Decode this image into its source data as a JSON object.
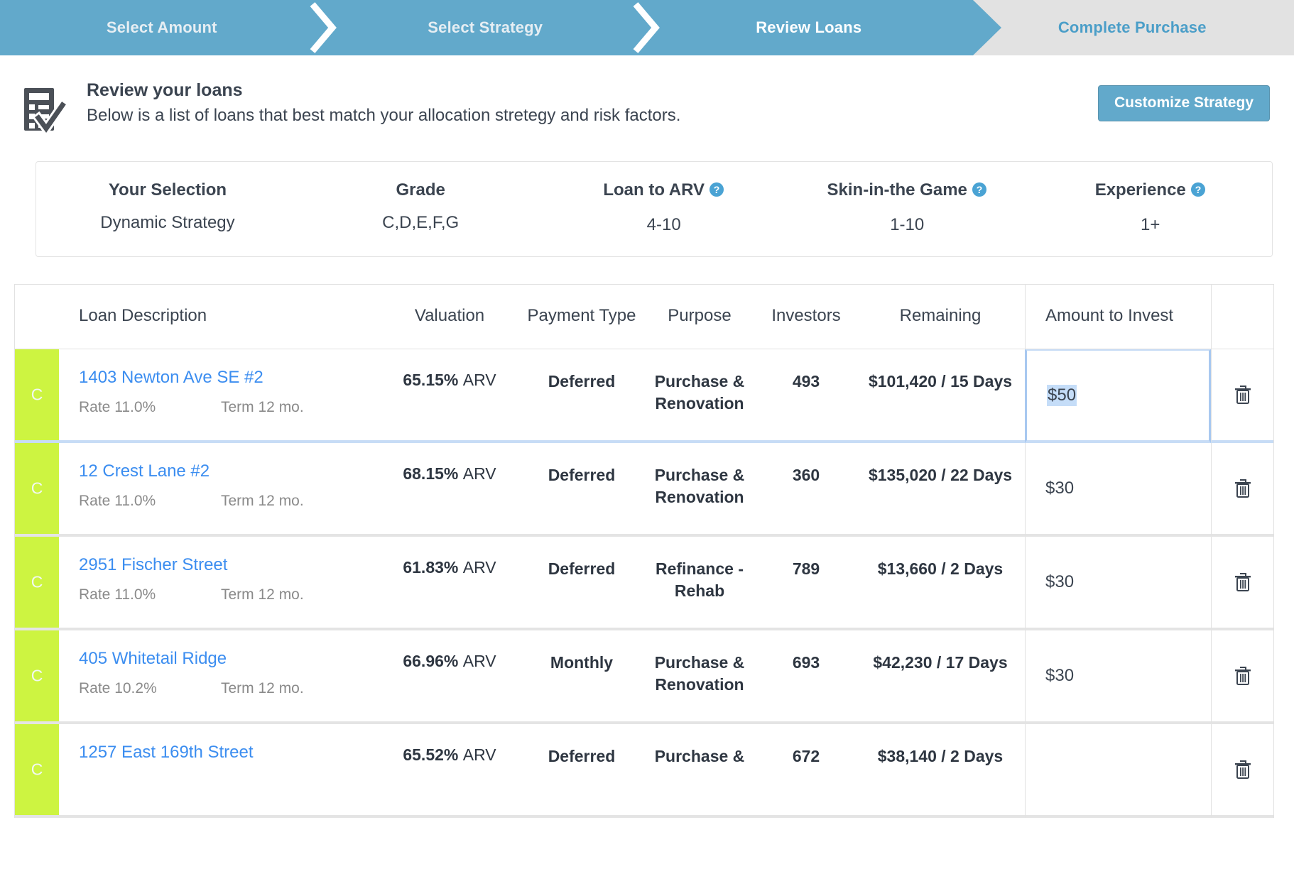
{
  "wizard": {
    "steps": [
      {
        "label": "Select Amount",
        "state": "done"
      },
      {
        "label": "Select Strategy",
        "state": "done"
      },
      {
        "label": "Review Loans",
        "state": "active"
      },
      {
        "label": "Complete Purchase",
        "state": "todo"
      }
    ],
    "fill_color": "#62a9cb",
    "track_color": "#e2e2e2"
  },
  "header": {
    "icon": "clipboard-check-icon",
    "title": "Review your loans",
    "subtitle": "Below is a list of loans that best match your allocation stretegy and risk factors.",
    "customize_button": "Customize Strategy"
  },
  "summary": {
    "columns": [
      {
        "label": "Your Selection",
        "value": "Dynamic Strategy",
        "help": false
      },
      {
        "label": "Grade",
        "value": "C,D,E,F,G",
        "help": false
      },
      {
        "label": "Loan to ARV",
        "value": "4-10",
        "help": true
      },
      {
        "label": "Skin-in-the Game",
        "value": "1-10",
        "help": true
      },
      {
        "label": "Experience",
        "value": "1+",
        "help": true
      }
    ],
    "help_color": "#4aa3d4"
  },
  "table": {
    "headers": {
      "grade": "",
      "description": "Loan Description",
      "valuation": "Valuation",
      "payment_type": "Payment Type",
      "purpose": "Purpose",
      "investors": "Investors",
      "remaining": "Remaining",
      "amount": "Amount to Invest",
      "delete": ""
    },
    "grade_color": "#cdf441",
    "link_color": "#3b8df0",
    "rows": [
      {
        "grade": "C",
        "name": "1403 Newton Ave SE #2",
        "rate": "Rate 11.0%",
        "term": "Term 12 mo.",
        "valuation_value": "65.15%",
        "valuation_unit": "ARV",
        "payment_type": "Deferred",
        "purpose": "Purchase & Renovation",
        "investors": "493",
        "remaining": "$101,420 / 15 Days",
        "amount": "$50",
        "amount_selected": true,
        "delete_icon": "trash-icon"
      },
      {
        "grade": "C",
        "name": "12 Crest Lane #2",
        "rate": "Rate 11.0%",
        "term": "Term 12 mo.",
        "valuation_value": "68.15%",
        "valuation_unit": "ARV",
        "payment_type": "Deferred",
        "purpose": "Purchase & Renovation",
        "investors": "360",
        "remaining": "$135,020 / 22 Days",
        "amount": "$30",
        "amount_selected": false,
        "delete_icon": "trash-icon"
      },
      {
        "grade": "C",
        "name": "2951 Fischer Street",
        "rate": "Rate 11.0%",
        "term": "Term 12 mo.",
        "valuation_value": "61.83%",
        "valuation_unit": "ARV",
        "payment_type": "Deferred",
        "purpose": "Refinance - Rehab",
        "investors": "789",
        "remaining": "$13,660 / 2 Days",
        "amount": "$30",
        "amount_selected": false,
        "delete_icon": "trash-icon"
      },
      {
        "grade": "C",
        "name": "405 Whitetail Ridge",
        "rate": "Rate 10.2%",
        "term": "Term 12 mo.",
        "valuation_value": "66.96%",
        "valuation_unit": "ARV",
        "payment_type": "Monthly",
        "purpose": "Purchase & Renovation",
        "investors": "693",
        "remaining": "$42,230 / 17 Days",
        "amount": "$30",
        "amount_selected": false,
        "delete_icon": "trash-icon"
      },
      {
        "grade": "C",
        "name": "1257 East 169th Street",
        "rate": "",
        "term": "",
        "valuation_value": "65.52%",
        "valuation_unit": "ARV",
        "payment_type": "Deferred",
        "purpose": "Purchase &",
        "investors": "672",
        "remaining": "$38,140 / 2 Days",
        "amount": "",
        "amount_selected": false,
        "delete_icon": "trash-icon"
      }
    ]
  }
}
